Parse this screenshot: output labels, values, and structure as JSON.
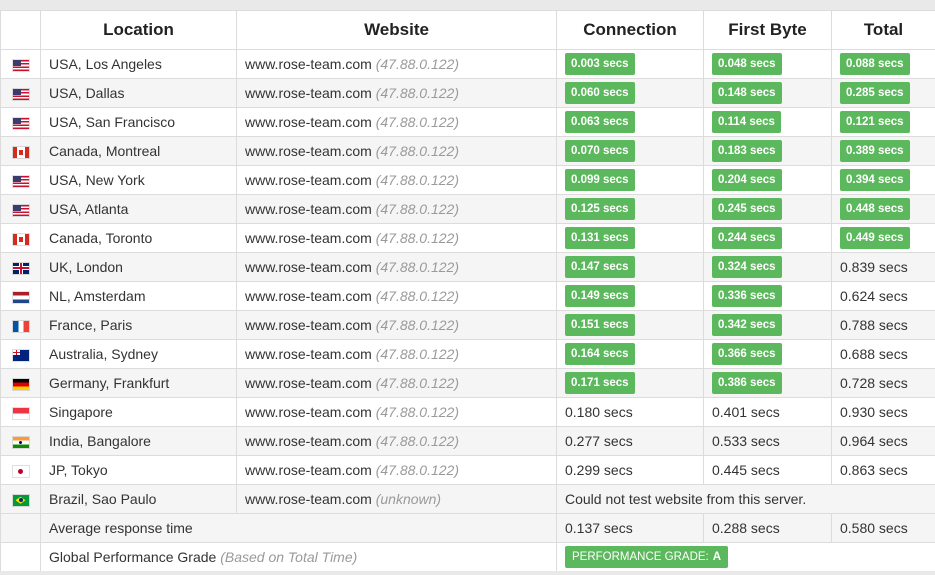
{
  "headers": {
    "location": "Location",
    "website": "Website",
    "connection": "Connection",
    "first_byte": "First Byte",
    "total": "Total"
  },
  "rows": [
    {
      "flag": "us-flag-icon",
      "location": "USA, Los Angeles",
      "site": "www.rose-team.com",
      "ip": "(47.88.0.122)",
      "connection": "0.003 secs",
      "first_byte": "0.048 secs",
      "total": "0.088 secs",
      "badge_connection": true,
      "badge_first_byte": true,
      "badge_total": true
    },
    {
      "flag": "us-flag-icon",
      "location": "USA, Dallas",
      "site": "www.rose-team.com",
      "ip": "(47.88.0.122)",
      "connection": "0.060 secs",
      "first_byte": "0.148 secs",
      "total": "0.285 secs",
      "badge_connection": true,
      "badge_first_byte": true,
      "badge_total": true
    },
    {
      "flag": "us-flag-icon",
      "location": "USA, San Francisco",
      "site": "www.rose-team.com",
      "ip": "(47.88.0.122)",
      "connection": "0.063 secs",
      "first_byte": "0.114 secs",
      "total": "0.121 secs",
      "badge_connection": true,
      "badge_first_byte": true,
      "badge_total": true
    },
    {
      "flag": "ca-flag-icon",
      "location": "Canada, Montreal",
      "site": "www.rose-team.com",
      "ip": "(47.88.0.122)",
      "connection": "0.070 secs",
      "first_byte": "0.183 secs",
      "total": "0.389 secs",
      "badge_connection": true,
      "badge_first_byte": true,
      "badge_total": true
    },
    {
      "flag": "us-flag-icon",
      "location": "USA, New York",
      "site": "www.rose-team.com",
      "ip": "(47.88.0.122)",
      "connection": "0.099 secs",
      "first_byte": "0.204 secs",
      "total": "0.394 secs",
      "badge_connection": true,
      "badge_first_byte": true,
      "badge_total": true
    },
    {
      "flag": "us-flag-icon",
      "location": "USA, Atlanta",
      "site": "www.rose-team.com",
      "ip": "(47.88.0.122)",
      "connection": "0.125 secs",
      "first_byte": "0.245 secs",
      "total": "0.448 secs",
      "badge_connection": true,
      "badge_first_byte": true,
      "badge_total": true
    },
    {
      "flag": "ca-flag-icon",
      "location": "Canada, Toronto",
      "site": "www.rose-team.com",
      "ip": "(47.88.0.122)",
      "connection": "0.131 secs",
      "first_byte": "0.244 secs",
      "total": "0.449 secs",
      "badge_connection": true,
      "badge_first_byte": true,
      "badge_total": true
    },
    {
      "flag": "uk-flag-icon",
      "location": "UK, London",
      "site": "www.rose-team.com",
      "ip": "(47.88.0.122)",
      "connection": "0.147 secs",
      "first_byte": "0.324 secs",
      "total": "0.839 secs",
      "badge_connection": true,
      "badge_first_byte": true,
      "badge_total": false
    },
    {
      "flag": "nl-flag-icon",
      "location": "NL, Amsterdam",
      "site": "www.rose-team.com",
      "ip": "(47.88.0.122)",
      "connection": "0.149 secs",
      "first_byte": "0.336 secs",
      "total": "0.624 secs",
      "badge_connection": true,
      "badge_first_byte": true,
      "badge_total": false
    },
    {
      "flag": "fr-flag-icon",
      "location": "France, Paris",
      "site": "www.rose-team.com",
      "ip": "(47.88.0.122)",
      "connection": "0.151 secs",
      "first_byte": "0.342 secs",
      "total": "0.788 secs",
      "badge_connection": true,
      "badge_first_byte": true,
      "badge_total": false
    },
    {
      "flag": "au-flag-icon",
      "location": "Australia, Sydney",
      "site": "www.rose-team.com",
      "ip": "(47.88.0.122)",
      "connection": "0.164 secs",
      "first_byte": "0.366 secs",
      "total": "0.688 secs",
      "badge_connection": true,
      "badge_first_byte": true,
      "badge_total": false
    },
    {
      "flag": "de-flag-icon",
      "location": "Germany, Frankfurt",
      "site": "www.rose-team.com",
      "ip": "(47.88.0.122)",
      "connection": "0.171 secs",
      "first_byte": "0.386 secs",
      "total": "0.728 secs",
      "badge_connection": true,
      "badge_first_byte": true,
      "badge_total": false
    },
    {
      "flag": "sg-flag-icon",
      "location": "Singapore",
      "site": "www.rose-team.com",
      "ip": "(47.88.0.122)",
      "connection": "0.180 secs",
      "first_byte": "0.401 secs",
      "total": "0.930 secs",
      "badge_connection": false,
      "badge_first_byte": false,
      "badge_total": false
    },
    {
      "flag": "in-flag-icon",
      "location": "India, Bangalore",
      "site": "www.rose-team.com",
      "ip": "(47.88.0.122)",
      "connection": "0.277 secs",
      "first_byte": "0.533 secs",
      "total": "0.964 secs",
      "badge_connection": false,
      "badge_first_byte": false,
      "badge_total": false
    },
    {
      "flag": "jp-flag-icon",
      "location": "JP, Tokyo",
      "site": "www.rose-team.com",
      "ip": "(47.88.0.122)",
      "connection": "0.299 secs",
      "first_byte": "0.445 secs",
      "total": "0.863 secs",
      "badge_connection": false,
      "badge_first_byte": false,
      "badge_total": false
    }
  ],
  "failed_row": {
    "flag": "br-flag-icon",
    "location": "Brazil, Sao Paulo",
    "site": "www.rose-team.com",
    "ip": "(unknown)",
    "message": "Could not test website from this server."
  },
  "average": {
    "label": "Average response time",
    "connection": "0.137 secs",
    "first_byte": "0.288 secs",
    "total": "0.580 secs"
  },
  "grade": {
    "label": "Global Performance Grade",
    "note": "(Based on Total Time)",
    "badge_label": "PERFORMANCE GRADE:",
    "badge_value": "A"
  },
  "colors": {
    "badge_green": "#5cb85c",
    "row_alt": "#f5f5f5",
    "border": "#dcdcdc",
    "muted_text": "#9a9a9a"
  }
}
